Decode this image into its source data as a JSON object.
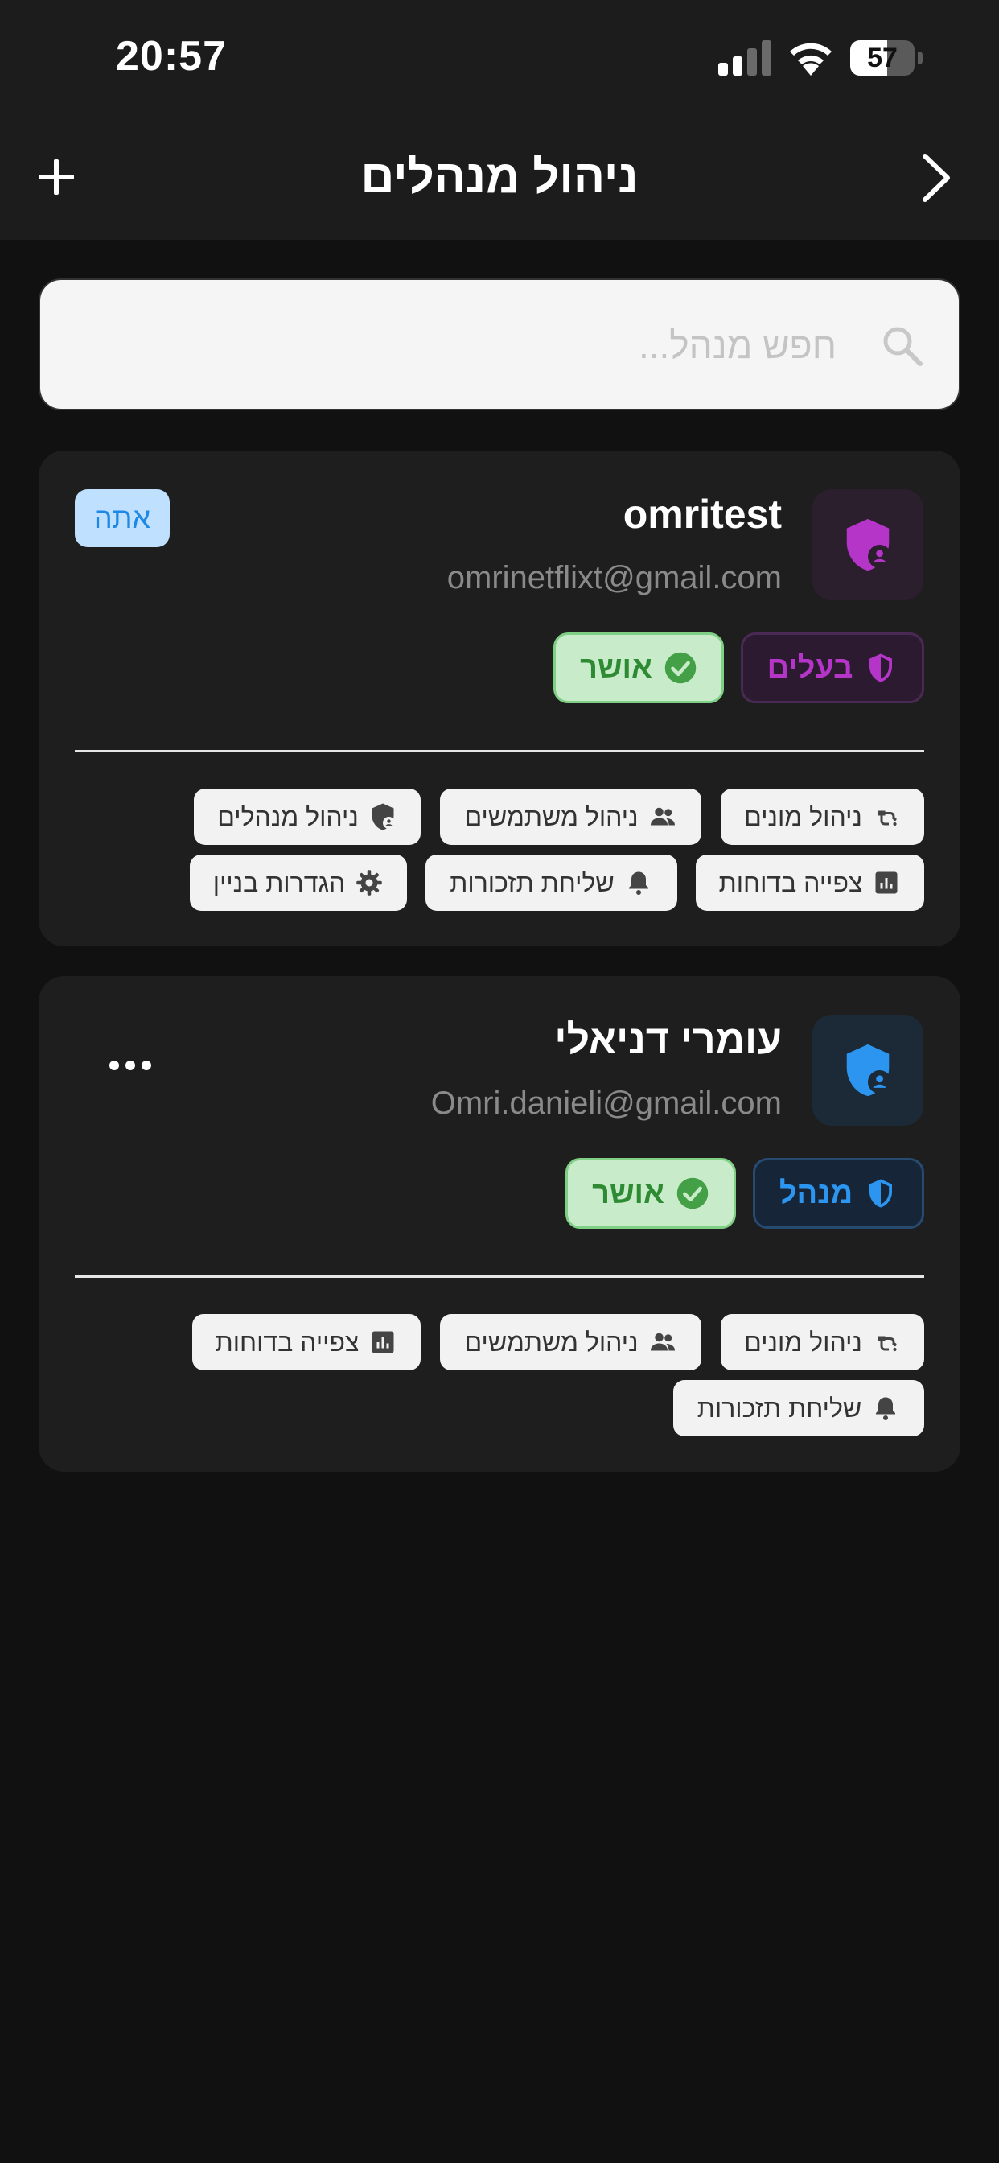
{
  "status_bar": {
    "time": "20:57",
    "battery": "57",
    "battery_level": 0.57
  },
  "header": {
    "title": "ניהול מנהלים",
    "add_icon": "plus-icon",
    "back_icon": "chevron-right-icon"
  },
  "search": {
    "placeholder": "חפש מנהל...",
    "icon": "search-icon"
  },
  "managers": [
    {
      "name": "omritest",
      "email": "omrinetflixt@gmail.com",
      "badge": "אתה",
      "role": "בעלים",
      "status": "אושר",
      "colors": {
        "role": "#b535c9",
        "avatar_bg": "#2b1f2e"
      },
      "permissions": [
        {
          "label": "ניהול מונים",
          "icon": "meter-icon"
        },
        {
          "label": "ניהול משתמשים",
          "icon": "people-icon"
        },
        {
          "label": "ניהול מנהלים",
          "icon": "admin-shield-icon"
        },
        {
          "label": "צפייה בדוחות",
          "icon": "report-icon"
        },
        {
          "label": "שליחת תזכורות",
          "icon": "bell-icon"
        },
        {
          "label": "הגדרות בניין",
          "icon": "gear-icon"
        }
      ]
    },
    {
      "name": "עומרי דניאלי",
      "email": "Omri.danieli@gmail.com",
      "role": "מנהל",
      "status": "אושר",
      "more_icon": "more-horizontal-icon",
      "colors": {
        "role": "#2b95f0",
        "avatar_bg": "#1c2a38"
      },
      "permissions": [
        {
          "label": "ניהול מונים",
          "icon": "meter-icon"
        },
        {
          "label": "ניהול משתמשים",
          "icon": "people-icon"
        },
        {
          "label": "צפייה בדוחות",
          "icon": "report-icon"
        },
        {
          "label": "שליחת תזכורות",
          "icon": "bell-icon"
        }
      ]
    }
  ],
  "colors": {
    "background": "#111111",
    "card": "#1e1e1e",
    "approved_bg": "#c8ebc9",
    "approved_text": "#2e8b33"
  }
}
